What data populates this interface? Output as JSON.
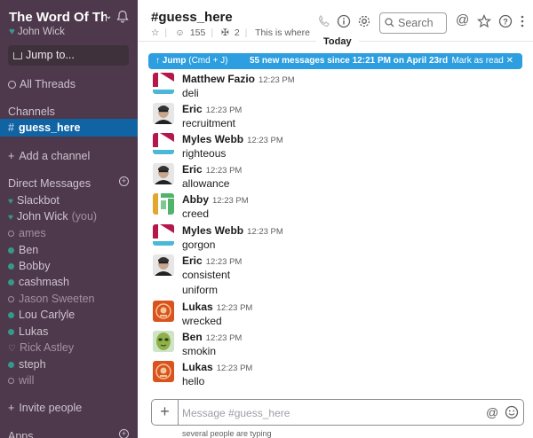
{
  "sidebar": {
    "workspace_name": "The Word Of Th...",
    "user": "John Wick",
    "jump_label": "Jump to...",
    "all_threads": "All Threads",
    "channels_heading": "Channels",
    "active_channel": "guess_here",
    "add_channel": "Add a channel",
    "dm_heading": "Direct Messages",
    "dms": [
      {
        "name": "Slackbot",
        "status": "heart"
      },
      {
        "name": "John Wick",
        "status": "on",
        "suffix": "(you)"
      },
      {
        "name": "ames",
        "status": "off"
      },
      {
        "name": "Ben",
        "status": "on"
      },
      {
        "name": "Bobby",
        "status": "on"
      },
      {
        "name": "cashmash",
        "status": "on"
      },
      {
        "name": "Jason Sweeten",
        "status": "off"
      },
      {
        "name": "Lou Carlyle",
        "status": "on"
      },
      {
        "name": "Lukas",
        "status": "on"
      },
      {
        "name": "Rick Astley",
        "status": "off"
      },
      {
        "name": "steph",
        "status": "on"
      },
      {
        "name": "will",
        "status": "off"
      }
    ],
    "invite": "Invite people",
    "apps_heading": "Apps"
  },
  "header": {
    "channel_title": "#guess_here",
    "members": "155",
    "pins": "2",
    "description": "This is where the game",
    "search_placeholder": "Search"
  },
  "divider_label": "Today",
  "banner": {
    "jump": "Jump",
    "shortcut": "(Cmd + J)",
    "message": "55 new messages since 12:21 PM on April 23rd",
    "mark_read": "Mark as read"
  },
  "messages": [
    {
      "author": "Matthew Fazio",
      "time": "12:23 PM",
      "text": "deli",
      "avatar": "red-teal"
    },
    {
      "author": "Eric",
      "time": "12:23 PM",
      "text": "recruitment",
      "avatar": "photo"
    },
    {
      "author": "Myles Webb",
      "time": "12:23 PM",
      "text": "righteous",
      "avatar": "red-teal"
    },
    {
      "author": "Eric",
      "time": "12:23 PM",
      "text": "allowance",
      "avatar": "photo"
    },
    {
      "author": "Abby",
      "time": "12:23 PM",
      "text": "creed",
      "avatar": "green-yellow"
    },
    {
      "author": "Myles Webb",
      "time": "12:23 PM",
      "text": "gorgon",
      "avatar": "red-teal"
    },
    {
      "author": "Eric",
      "time": "12:23 PM",
      "text": "consistent",
      "avatar": "photo"
    },
    {
      "author": "",
      "time": "",
      "text": "uniform",
      "avatar": ""
    },
    {
      "author": "Lukas",
      "time": "12:23 PM",
      "text": "wrecked",
      "avatar": "badge"
    },
    {
      "author": "Ben",
      "time": "12:23 PM",
      "text": "smokin",
      "avatar": "alien"
    },
    {
      "author": "Lukas",
      "time": "12:23 PM",
      "text": "hello",
      "avatar": "badge"
    }
  ],
  "composer": {
    "placeholder": "Message #guess_here",
    "typing": "several people are typing"
  },
  "colors": {
    "sidebar_bg": "#4d394b",
    "active_channel": "#1164a3",
    "banner": "#2d9ee0",
    "presence_online": "#38978d"
  }
}
